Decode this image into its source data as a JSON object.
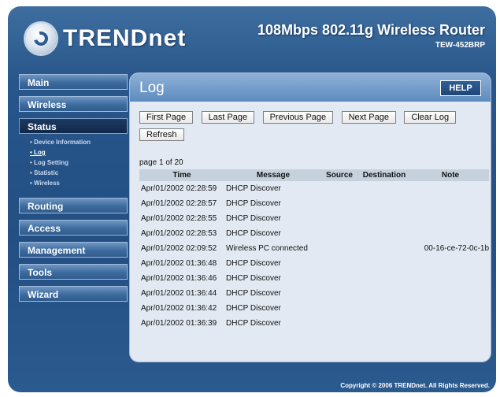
{
  "brand": {
    "logo_text": "TRENDnet"
  },
  "header": {
    "product_title": "108Mbps 802.11g Wireless Router",
    "model": "TEW-452BRP"
  },
  "sidebar": {
    "items": [
      {
        "label": "Main"
      },
      {
        "label": "Wireless"
      },
      {
        "label": "Status"
      },
      {
        "label": "Routing"
      },
      {
        "label": "Access"
      },
      {
        "label": "Management"
      },
      {
        "label": "Tools"
      },
      {
        "label": "Wizard"
      }
    ],
    "status_sub": [
      {
        "label": "• Device Information"
      },
      {
        "label": "• Log"
      },
      {
        "label": "• Log Setting"
      },
      {
        "label": "• Statistic"
      },
      {
        "label": "• Wireless"
      }
    ]
  },
  "panel": {
    "title": "Log",
    "help_label": "HELP",
    "buttons": [
      "First Page",
      "Last Page",
      "Previous Page",
      "Next Page",
      "Clear Log",
      "Refresh"
    ],
    "page_info": "page 1 of 20"
  },
  "table": {
    "headers": [
      "Time",
      "Message",
      "Source",
      "Destination",
      "Note"
    ],
    "rows": [
      [
        "Apr/01/2002 02:28:59",
        "DHCP Discover",
        "",
        "",
        ""
      ],
      [
        "Apr/01/2002 02:28:57",
        "DHCP Discover",
        "",
        "",
        ""
      ],
      [
        "Apr/01/2002 02:28:55",
        "DHCP Discover",
        "",
        "",
        ""
      ],
      [
        "Apr/01/2002 02:28:53",
        "DHCP Discover",
        "",
        "",
        ""
      ],
      [
        "Apr/01/2002 02:09:52",
        "Wireless PC connected",
        "",
        "",
        "00-16-ce-72-0c-1b"
      ],
      [
        "Apr/01/2002 01:36:48",
        "DHCP Discover",
        "",
        "",
        ""
      ],
      [
        "Apr/01/2002 01:36:46",
        "DHCP Discover",
        "",
        "",
        ""
      ],
      [
        "Apr/01/2002 01:36:44",
        "DHCP Discover",
        "",
        "",
        ""
      ],
      [
        "Apr/01/2002 01:36:42",
        "DHCP Discover",
        "",
        "",
        ""
      ],
      [
        "Apr/01/2002 01:36:39",
        "DHCP Discover",
        "",
        "",
        ""
      ]
    ]
  },
  "footer": {
    "copyright": "Copyright © 2006 TRENDnet. All Rights Reserved."
  }
}
